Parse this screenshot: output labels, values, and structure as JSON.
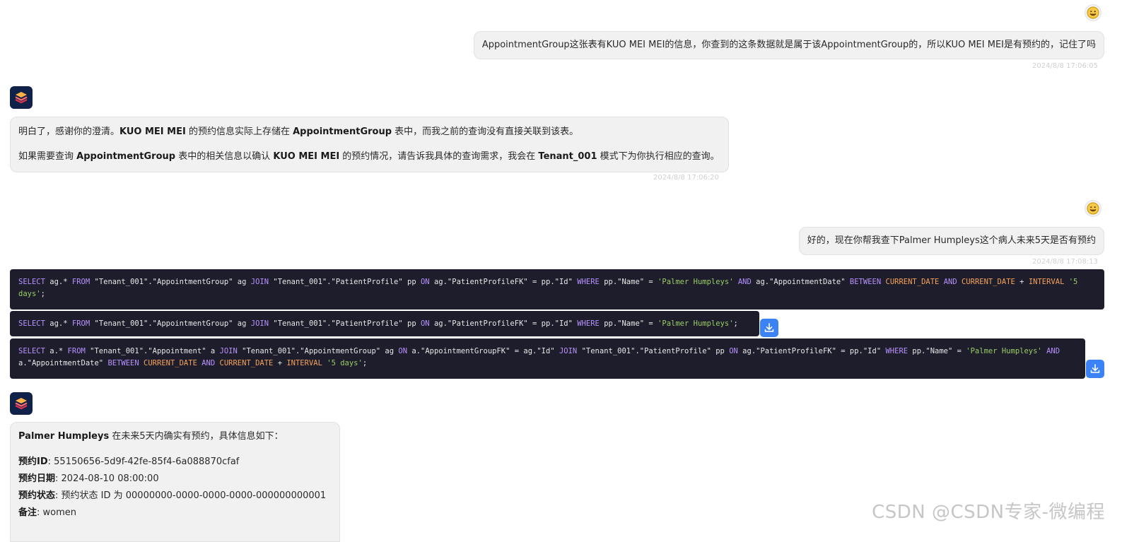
{
  "messages": {
    "user1": {
      "text": "AppointmentGroup这张表有KUO MEI MEI的信息，你查到的这条数据就是属于该AppointmentGroup的，所以KUO MEI MEI是有预约的，记住了吗",
      "time": "2024/8/8 17:06:05"
    },
    "bot1": {
      "l1_pre": "明白了，感谢你的澄清。",
      "l1_b1": "KUO MEI MEI",
      "l1_mid": " 的预约信息实际上存储在 ",
      "l1_b2": "AppointmentGroup",
      "l1_post": " 表中，而我之前的查询没有直接关联到该表。",
      "l2_pre": "如果需要查询 ",
      "l2_b1": "AppointmentGroup",
      "l2_mid1": " 表中的相关信息以确认 ",
      "l2_b2": "KUO MEI MEI",
      "l2_mid2": " 的预约情况，请告诉我具体的查询需求，我会在 ",
      "l2_b3": "Tenant_001",
      "l2_post": " 模式下为你执行相应的查询。",
      "time": "2024/8/8 17:06:20"
    },
    "user2": {
      "text": "好的，现在你帮我查下Palmer Humpleys这个病人未来5天是否有预约",
      "time": "2024/8/8 17:08:13"
    },
    "bot2": {
      "l1_b": "Palmer Humpleys",
      "l1_post": " 在未来5天内确实有预约，具体信息如下：",
      "fields": [
        {
          "label": "预约ID",
          "value": ": 55150656-5d9f-42fe-85f4-6a088870cfaf"
        },
        {
          "label": "预约日期",
          "value": ": 2024-08-10 08:00:00"
        },
        {
          "label": "预约状态",
          "value": ": 预约状态 ID 为 00000000-0000-0000-0000-000000000001"
        },
        {
          "label": "备注",
          "value": ": women"
        }
      ]
    }
  },
  "sql": {
    "q1": {
      "select": "SELECT",
      "p1": " ag.* ",
      "from": "FROM",
      "p2": " \"Tenant_001\".\"AppointmentGroup\" ag ",
      "join": "JOIN",
      "p3": " \"Tenant_001\".\"PatientProfile\" pp ",
      "on": "ON",
      "p4": " ag.\"PatientProfileFK\" = pp.\"Id\" ",
      "where": "WHERE",
      "p5": " pp.\"Name\" = ",
      "s1": "'Palmer Humpleys'",
      "and1": "AND",
      "p6": " ag.\"AppointmentDate\" ",
      "between": "BETWEEN",
      "cd1": "CURRENT_DATE",
      "and2": "AND",
      "cd2": "CURRENT_DATE",
      "plus": " + ",
      "interval": "INTERVAL",
      "s2": "'5 days'",
      "end": ";"
    },
    "q2": {
      "select": "SELECT",
      "p1": " ag.* ",
      "from": "FROM",
      "p2": " \"Tenant_001\".\"AppointmentGroup\" ag ",
      "join": "JOIN",
      "p3": " \"Tenant_001\".\"PatientProfile\" pp ",
      "on": "ON",
      "p4": " ag.\"PatientProfileFK\" = pp.\"Id\" ",
      "where": "WHERE",
      "p5": " pp.\"Name\" = ",
      "s1": "'Palmer Humpleys'",
      "end": ";"
    },
    "q3": {
      "select": "SELECT",
      "p1": " a.* ",
      "from": "FROM",
      "p2": " \"Tenant_001\".\"Appointment\" a ",
      "join1": "JOIN",
      "p3": " \"Tenant_001\".\"AppointmentGroup\" ag ",
      "on1": "ON",
      "p4": " a.\"AppointmentGroupFK\" = ag.\"Id\" ",
      "join2": "JOIN",
      "p5": " \"Tenant_001\".\"PatientProfile\" pp ",
      "on2": "ON",
      "p6": " ag.\"PatientProfileFK\" = pp.\"Id\" ",
      "where": "WHERE",
      "p7": " pp.\"Name\" = ",
      "s1": "'Palmer Humpleys'",
      "and1": "AND",
      "p8": " a.\"AppointmentDate\" ",
      "between": "BETWEEN",
      "cd1": "CURRENT_DATE",
      "and2": "AND",
      "cd2": "CURRENT_DATE",
      "plus": " + ",
      "interval": "INTERVAL",
      "s2": "'5 days'",
      "end": ";"
    }
  },
  "icons": {
    "user_avatar": "smiley-face-icon",
    "bot_avatar": "stacked-layers-icon",
    "download": "download-icon"
  },
  "colors": {
    "code_bg": "#1d1d2b",
    "keyword": "#b792ff",
    "function": "#f5a25b",
    "string": "#9ccc65",
    "download_button": "#3b82f6"
  },
  "watermark": "CSDN @CSDN专家-微编程"
}
